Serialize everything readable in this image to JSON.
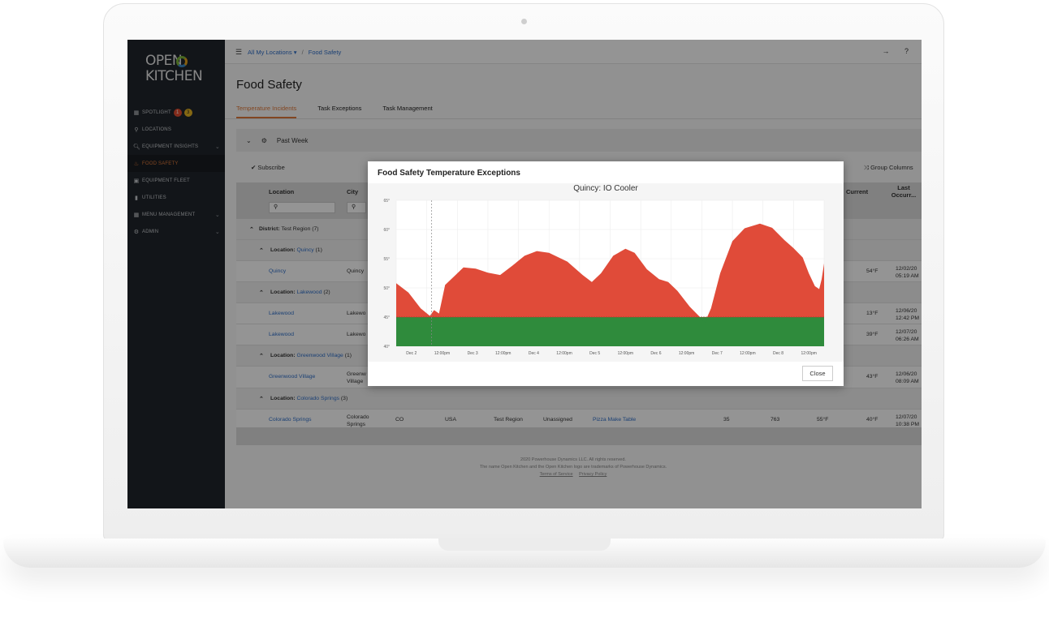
{
  "logo": {
    "line1": "OPEN",
    "line2": "KITCHEN"
  },
  "sidebar": {
    "items": [
      {
        "label": "Spotlight",
        "icon": "spotlight-icon",
        "glyph": "▦",
        "badges": [
          "1",
          "3"
        ]
      },
      {
        "label": "Locations",
        "icon": "location-pin-icon",
        "glyph": "⚲"
      },
      {
        "label": "Equipment Insights",
        "icon": "magnifier-icon",
        "glyph": "🔍︎",
        "chevron": true
      },
      {
        "label": "Food Safety",
        "icon": "food-safety-icon",
        "glyph": "♨",
        "active": true
      },
      {
        "label": "Equipment Fleet",
        "icon": "fleet-icon",
        "glyph": "▣"
      },
      {
        "label": "Utilities",
        "icon": "bar-chart-icon",
        "glyph": "▮"
      },
      {
        "label": "Menu Management",
        "icon": "grid-icon",
        "glyph": "▦",
        "chevron": true
      },
      {
        "label": "Admin",
        "icon": "admin-icon",
        "glyph": "⚙",
        "chevron": true
      }
    ]
  },
  "topbar": {
    "breadcrumb_root": "All My Locations",
    "breadcrumb_current": "Food Safety",
    "logout_icon": "→",
    "help_icon": "?"
  },
  "page": {
    "title": "Food Safety",
    "tabs": [
      "Temperature Incidents",
      "Task Exceptions",
      "Task Management"
    ]
  },
  "filter": {
    "period": "Past Week"
  },
  "toolbar": {
    "subscribe": "Subscribe",
    "group_columns": "Group Columns"
  },
  "table": {
    "headers": {
      "location": "Location",
      "city": "City",
      "current": "Current",
      "last": "Last Occurr..."
    },
    "district": {
      "label": "District:",
      "name": "Test Region (7)"
    },
    "groups": [
      {
        "label": "Location:",
        "name": "Quincy",
        "count": "(1)"
      },
      {
        "label": "Location:",
        "name": "Lakewood",
        "count": "(2)"
      },
      {
        "label": "Location:",
        "name": "Greenwood Village",
        "count": "(1)"
      },
      {
        "label": "Location:",
        "name": "Colorado Springs",
        "count": "(3)"
      }
    ],
    "rows": [
      {
        "location": "Quincy",
        "city": "Quincy",
        "current": "54°F",
        "last1": "12/02/20",
        "last2": "05:19 AM"
      },
      {
        "location": "Lakewood",
        "city": "Lakewo",
        "current": "13°F",
        "last1": "12/06/20",
        "last2": "12:42 PM"
      },
      {
        "location": "Lakewood",
        "city": "Lakewo",
        "current": "39°F",
        "last1": "12/07/20",
        "last2": "06:26 AM"
      },
      {
        "location": "Greenwood Village",
        "city": "Greenw",
        "city2": "Village",
        "current": "43°F",
        "last1": "12/06/20",
        "last2": "08:09 AM"
      },
      {
        "location": "Colorado Springs",
        "city": "Colorado",
        "city2": "Springs",
        "state": "CO",
        "country": "USA",
        "region": "Test Region",
        "assigned": "Unassigned",
        "equipment": "Pizza Make Table",
        "n1": "35",
        "n2": "763",
        "threshold": "55°F",
        "current": "40°F",
        "last1": "12/07/20",
        "last2": "10:38 PM"
      }
    ]
  },
  "footer": {
    "line1": "2020 Powerhouse Dynamics LLC. All rights reserved.",
    "line2": "The name Open Kitchen and the Open Kitchen logo are trademarks of Powerhouse Dynamics.",
    "terms": "Terms of Service",
    "privacy": "Privacy Policy"
  },
  "modal": {
    "title": "Food Safety Temperature Exceptions",
    "close": "Close"
  },
  "chart_data": {
    "type": "area",
    "title": "Quincy: IO Cooler",
    "ylim": [
      40,
      65
    ],
    "yticks": [
      "40°",
      "45°",
      "50°",
      "55°",
      "60°",
      "65°"
    ],
    "threshold": 45,
    "xlim": [
      0,
      7
    ],
    "xticks": [
      "Dec 2",
      "12:00pm",
      "Dec 3",
      "12:00pm",
      "Dec 4",
      "12:00pm",
      "Dec 5",
      "12:00pm",
      "Dec 6",
      "12:00pm",
      "Dec 7",
      "12:00pm",
      "Dec 8",
      "12:00pm"
    ],
    "colors": {
      "above": "#e04b39",
      "below": "#2f8b3c",
      "threshold_line": "#b03a2e"
    },
    "series": [
      {
        "values": [
          [
            0,
            50.8
          ],
          [
            0.2,
            49.2
          ],
          [
            0.4,
            46.5
          ],
          [
            0.55,
            45.2
          ],
          [
            0.62,
            46.2
          ],
          [
            0.7,
            45.6
          ],
          [
            0.8,
            50.5
          ],
          [
            0.95,
            52
          ],
          [
            1.1,
            53.5
          ],
          [
            1.3,
            53.3
          ],
          [
            1.5,
            52.6
          ],
          [
            1.7,
            52.2
          ],
          [
            1.9,
            53.8
          ],
          [
            2.1,
            55.5
          ],
          [
            2.3,
            56.3
          ],
          [
            2.5,
            56
          ],
          [
            2.8,
            54.5
          ],
          [
            3.05,
            52.2
          ],
          [
            3.2,
            51
          ],
          [
            3.35,
            52.5
          ],
          [
            3.55,
            55.5
          ],
          [
            3.75,
            56.7
          ],
          [
            3.9,
            56
          ],
          [
            4.1,
            53.2
          ],
          [
            4.3,
            51.5
          ],
          [
            4.45,
            51
          ],
          [
            4.6,
            49.5
          ],
          [
            4.8,
            46.8
          ],
          [
            4.95,
            45.2
          ],
          [
            5.05,
            44.1
          ],
          [
            5.15,
            46.5
          ],
          [
            5.3,
            52.5
          ],
          [
            5.5,
            58
          ],
          [
            5.7,
            60.2
          ],
          [
            5.95,
            61
          ],
          [
            6.15,
            60.3
          ],
          [
            6.35,
            58.2
          ],
          [
            6.5,
            56.8
          ],
          [
            6.65,
            55.2
          ],
          [
            6.75,
            52.5
          ],
          [
            6.85,
            50.3
          ],
          [
            6.92,
            49.8
          ],
          [
            6.96,
            51.5
          ],
          [
            7.0,
            54.2
          ]
        ]
      }
    ]
  }
}
